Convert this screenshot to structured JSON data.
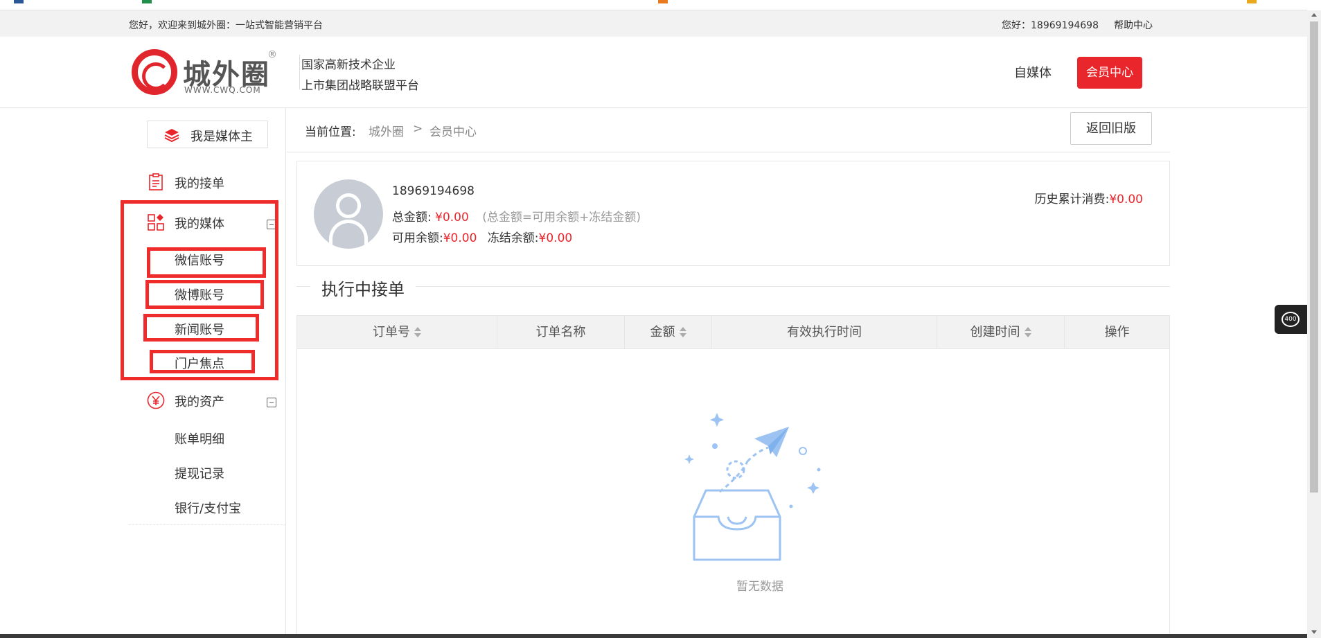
{
  "topbar": {
    "welcome": "您好，欢迎来到城外圈：一站式智能营销平台",
    "user": "您好：18969194698",
    "help": "帮助中心"
  },
  "header": {
    "logo_name": "城外圈",
    "logo_site": "WWW.CWQ.COM",
    "logo_reg": "®",
    "slogan1": "国家高新技术企业",
    "slogan2": "上市集团战略联盟平台",
    "nav_media": "自媒体",
    "nav_member": "会员中心"
  },
  "sidebar": {
    "media_owner_button": "我是媒体主",
    "my_orders": "我的接单",
    "my_media": "我的媒体",
    "media_items": [
      "微信账号",
      "微博账号",
      "新闻账号",
      "门户焦点"
    ],
    "my_assets": "我的资产",
    "asset_items": [
      "账单明细",
      "提现记录",
      "银行/支付宝"
    ]
  },
  "breadcrumb": {
    "label": "当前位置:",
    "home": "城外圈",
    "separator": ">",
    "current": "会员中心"
  },
  "back_button": "返回旧版",
  "account": {
    "phone": "18969194698",
    "total_label": "总金额:",
    "total_value": "¥0.00",
    "total_note": "(总金额=可用余额+冻结金额)",
    "available_label": "可用余额:",
    "available_value": "¥0.00",
    "frozen_label": "冻结余额:",
    "frozen_value": "¥0.00",
    "history_label": "历史累计消费:",
    "history_value": "¥0.00"
  },
  "section_title": "执行中接单",
  "table": {
    "columns": [
      "订单号",
      "订单名称",
      "金额",
      "有效执行时间",
      "创建时间",
      "操作"
    ],
    "empty_text": "暂无数据"
  },
  "float_phone": "400",
  "colors": {
    "brand_red": "#e8262c",
    "annotation_red": "#ee2c2c",
    "empty_icon_blue": "#9cc3f2"
  }
}
